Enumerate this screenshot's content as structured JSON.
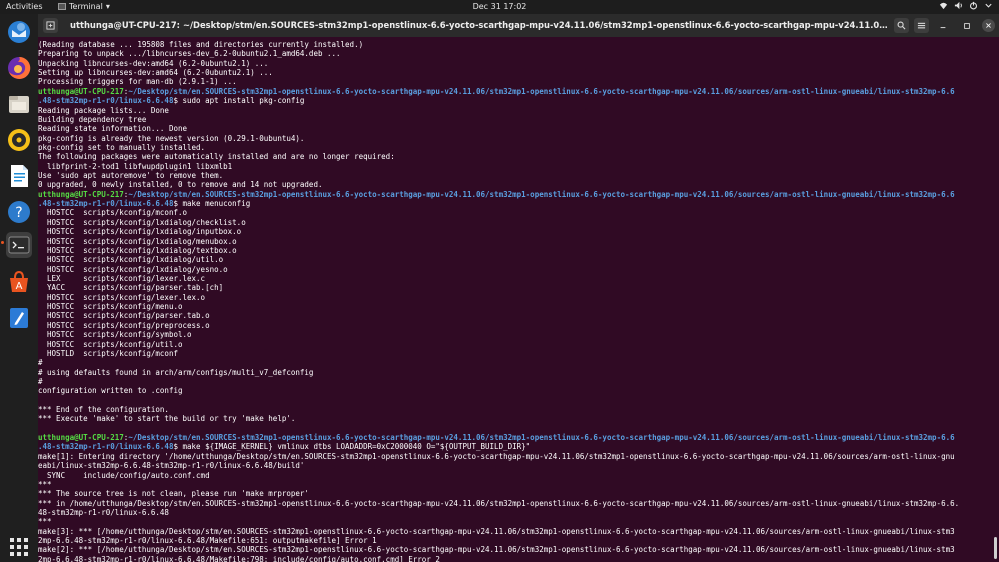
{
  "topbar": {
    "activities": "Activities",
    "app_name": "Terminal",
    "app_caret": "▾",
    "clock": "Dec 31  17:02",
    "icons": [
      "network-icon",
      "volume-icon",
      "power-icon"
    ]
  },
  "dock": {
    "items": [
      {
        "name": "thunderbird-icon",
        "color": "#2a7fd4"
      },
      {
        "name": "firefox-icon",
        "color": "#ff7139"
      },
      {
        "name": "files-icon",
        "color": "#d8d3c8"
      },
      {
        "name": "rhythmbox-icon",
        "color": "#f6c018"
      },
      {
        "name": "writer-icon",
        "color": "#1f8dd6"
      },
      {
        "name": "help-icon",
        "color": "#2d7bcc"
      },
      {
        "name": "terminal-icon",
        "color": "#3b3b3b"
      },
      {
        "name": "software-icon",
        "color": "#e95420"
      },
      {
        "name": "text-editor-icon",
        "color": "#2c7bd6"
      }
    ],
    "apps_grid": "show-apps-icon"
  },
  "window": {
    "title": "utthunga@UT-CPU-217: ~/Desktop/stm/en.SOURCES-stm32mp1-openstlinux-6.6-yocto-scarthgap-mpu-v24.11.06/stm32mp1-openstlinux-6.6-yocto-scarthgap-mpu-v24.11.06/sources/arm-ostl-linux-gnueabi/linux-stm32m..."
  },
  "terminal": {
    "user": "utthunga@UT-CPU-217",
    "lines": [
      {
        "t": "(Reading database ... 195808 files and directories currently installed.)"
      },
      {
        "t": "Preparing to unpack .../libncurses-dev_6.2-0ubuntu2.1_amd64.deb ..."
      },
      {
        "t": "Unpacking libncurses-dev:amd64 (6.2-0ubuntu2.1) ..."
      },
      {
        "t": "Setting up libncurses-dev:amd64 (6.2-0ubuntu2.1) ..."
      },
      {
        "t": "Processing triggers for man-db (2.9.1-1) ..."
      },
      {
        "u": "utthunga@UT-CPU-217",
        "sep": ":",
        "p": "~/Desktop/stm/en.SOURCES-stm32mp1-openstlinux-6.6-yocto-scarthgap-mpu-v24.11.06/stm32mp1-openstlinux-6.6-yocto-scarthgap-mpu-v24.11.06/sources/arm-ostl-linux-gnueabi/linux-stm32mp-6.6"
      },
      {
        "p": ".48-stm32mp-r1-r0/linux-6.6.48",
        "t": "$ sudo apt install pkg-config"
      },
      {
        "t": "Reading package lists... Done"
      },
      {
        "t": "Building dependency tree"
      },
      {
        "t": "Reading state information... Done"
      },
      {
        "t": "pkg-config is already the newest version (0.29.1-0ubuntu4)."
      },
      {
        "t": "pkg-config set to manually installed."
      },
      {
        "t": "The following packages were automatically installed and are no longer required:"
      },
      {
        "t": "  libfprint-2-tod1 libfwupdplugin1 libxmlb1"
      },
      {
        "t": "Use 'sudo apt autoremove' to remove them."
      },
      {
        "t": "0 upgraded, 0 newly installed, 0 to remove and 14 not upgraded."
      },
      {
        "u": "utthunga@UT-CPU-217",
        "sep": ":",
        "p": "~/Desktop/stm/en.SOURCES-stm32mp1-openstlinux-6.6-yocto-scarthgap-mpu-v24.11.06/stm32mp1-openstlinux-6.6-yocto-scarthgap-mpu-v24.11.06/sources/arm-ostl-linux-gnueabi/linux-stm32mp-6.6"
      },
      {
        "p": ".48-stm32mp-r1-r0/linux-6.6.48",
        "t": "$ make menuconfig"
      },
      {
        "t": "  HOSTCC  scripts/kconfig/mconf.o"
      },
      {
        "t": "  HOSTCC  scripts/kconfig/lxdialog/checklist.o"
      },
      {
        "t": "  HOSTCC  scripts/kconfig/lxdialog/inputbox.o"
      },
      {
        "t": "  HOSTCC  scripts/kconfig/lxdialog/menubox.o"
      },
      {
        "t": "  HOSTCC  scripts/kconfig/lxdialog/textbox.o"
      },
      {
        "t": "  HOSTCC  scripts/kconfig/lxdialog/util.o"
      },
      {
        "t": "  HOSTCC  scripts/kconfig/lxdialog/yesno.o"
      },
      {
        "t": "  LEX     scripts/kconfig/lexer.lex.c"
      },
      {
        "t": "  YACC    scripts/kconfig/parser.tab.[ch]"
      },
      {
        "t": "  HOSTCC  scripts/kconfig/lexer.lex.o"
      },
      {
        "t": "  HOSTCC  scripts/kconfig/menu.o"
      },
      {
        "t": "  HOSTCC  scripts/kconfig/parser.tab.o"
      },
      {
        "t": "  HOSTCC  scripts/kconfig/preprocess.o"
      },
      {
        "t": "  HOSTCC  scripts/kconfig/symbol.o"
      },
      {
        "t": "  HOSTCC  scripts/kconfig/util.o"
      },
      {
        "t": "  HOSTLD  scripts/kconfig/mconf"
      },
      {
        "t": "#"
      },
      {
        "t": "# using defaults found in arch/arm/configs/multi_v7_defconfig"
      },
      {
        "t": "#"
      },
      {
        "t": "configuration written to .config"
      },
      {
        "t": ""
      },
      {
        "t": "*** End of the configuration."
      },
      {
        "t": "*** Execute 'make' to start the build or try 'make help'."
      },
      {
        "t": ""
      },
      {
        "u": "utthunga@UT-CPU-217",
        "sep": ":",
        "p": "~/Desktop/stm/en.SOURCES-stm32mp1-openstlinux-6.6-yocto-scarthgap-mpu-v24.11.06/stm32mp1-openstlinux-6.6-yocto-scarthgap-mpu-v24.11.06/sources/arm-ostl-linux-gnueabi/linux-stm32mp-6.6"
      },
      {
        "p": ".48-stm32mp-r1-r0/linux-6.6.48",
        "t": "$ make ${IMAGE_KERNEL} vmlinux dtbs LOADADDR=0xC2000040 O=\"${OUTPUT_BUILD_DIR}\""
      },
      {
        "t": "make[1]: Entering directory '/home/utthunga/Desktop/stm/en.SOURCES-stm32mp1-openstlinux-6.6-yocto-scarthgap-mpu-v24.11.06/stm32mp1-openstlinux-6.6-yocto-scarthgap-mpu-v24.11.06/sources/arm-ostl-linux-gnu"
      },
      {
        "t": "eabi/linux-stm32mp-6.6.48-stm32mp-r1-r0/linux-6.6.48/build'"
      },
      {
        "t": "  SYNC    include/config/auto.conf.cmd"
      },
      {
        "t": "***"
      },
      {
        "t": "*** The source tree is not clean, please run 'make mrproper'"
      },
      {
        "t": "*** in /home/utthunga/Desktop/stm/en.SOURCES-stm32mp1-openstlinux-6.6-yocto-scarthgap-mpu-v24.11.06/stm32mp1-openstlinux-6.6-yocto-scarthgap-mpu-v24.11.06/sources/arm-ostl-linux-gnueabi/linux-stm32mp-6.6."
      },
      {
        "t": "48-stm32mp-r1-r0/linux-6.6.48"
      },
      {
        "t": "***"
      },
      {
        "t": "make[3]: *** [/home/utthunga/Desktop/stm/en.SOURCES-stm32mp1-openstlinux-6.6-yocto-scarthgap-mpu-v24.11.06/stm32mp1-openstlinux-6.6-yocto-scarthgap-mpu-v24.11.06/sources/arm-ostl-linux-gnueabi/linux-stm3"
      },
      {
        "t": "2mp-6.6.48-stm32mp-r1-r0/linux-6.6.48/Makefile:651: outputmakefile] Error 1"
      },
      {
        "t": "make[2]: *** [/home/utthunga/Desktop/stm/en.SOURCES-stm32mp1-openstlinux-6.6-yocto-scarthgap-mpu-v24.11.06/stm32mp1-openstlinux-6.6-yocto-scarthgap-mpu-v24.11.06/sources/arm-ostl-linux-gnueabi/linux-stm3"
      },
      {
        "t": "2mp-6.6.48-stm32mp-r1-r0/linux-6.6.48/Makefile:798: include/config/auto.conf.cmd] Error 2"
      }
    ]
  }
}
